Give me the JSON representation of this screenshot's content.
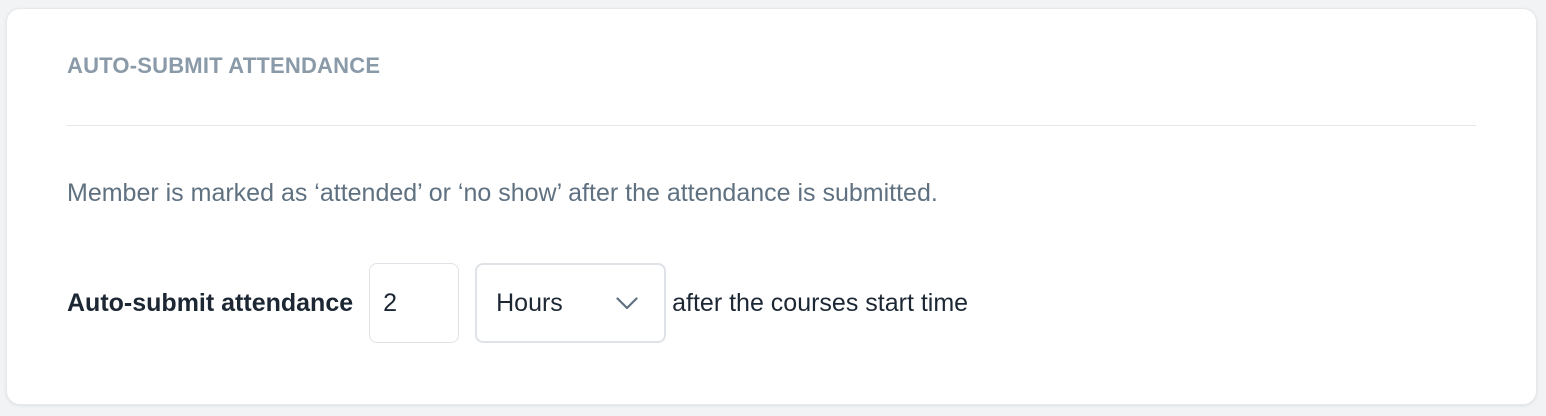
{
  "section": {
    "title": "AUTO-SUBMIT ATTENDANCE",
    "description": "Member is marked as ‘attended’ or ‘no show’ after the attendance is submitted."
  },
  "setting": {
    "label": "Auto-submit attendance",
    "amount_value": "2",
    "unit_select": {
      "selected": "Hours",
      "icon": "chevron-down-icon"
    },
    "suffix": "after the courses start time"
  },
  "colors": {
    "title": "#8a9aa8",
    "description": "#5f7180",
    "text": "#1c2733",
    "border": "#dfe3e7",
    "divider": "#e3e6ea"
  }
}
